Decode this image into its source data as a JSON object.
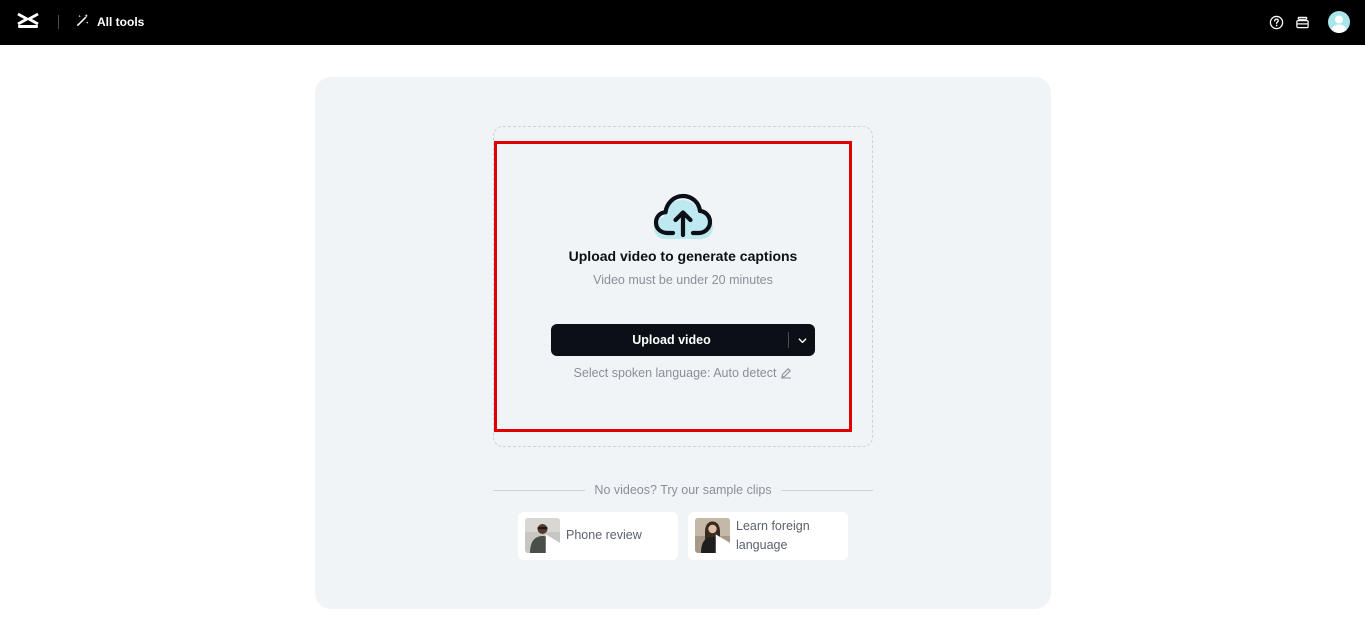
{
  "topbar": {
    "all_tools_label": "All tools",
    "icons": [
      "capcut-logo-icon",
      "magic-wand-icon",
      "help-icon",
      "stack-icon",
      "avatar"
    ]
  },
  "upload": {
    "title": "Upload video to generate captions",
    "subtitle": "Video must be under 20 minutes",
    "button_label": "Upload video",
    "language_label": "Select spoken language: Auto detect"
  },
  "samples": {
    "heading": "No videos? Try our sample clips",
    "items": [
      {
        "label": "Phone review"
      },
      {
        "label": "Learn foreign language"
      }
    ]
  },
  "colors": {
    "topbar": "#000000",
    "panel": "#f1f4f7",
    "button": "#0c0f16",
    "highlight": "#e00000",
    "cloud_accent": "#bfe9f0"
  }
}
